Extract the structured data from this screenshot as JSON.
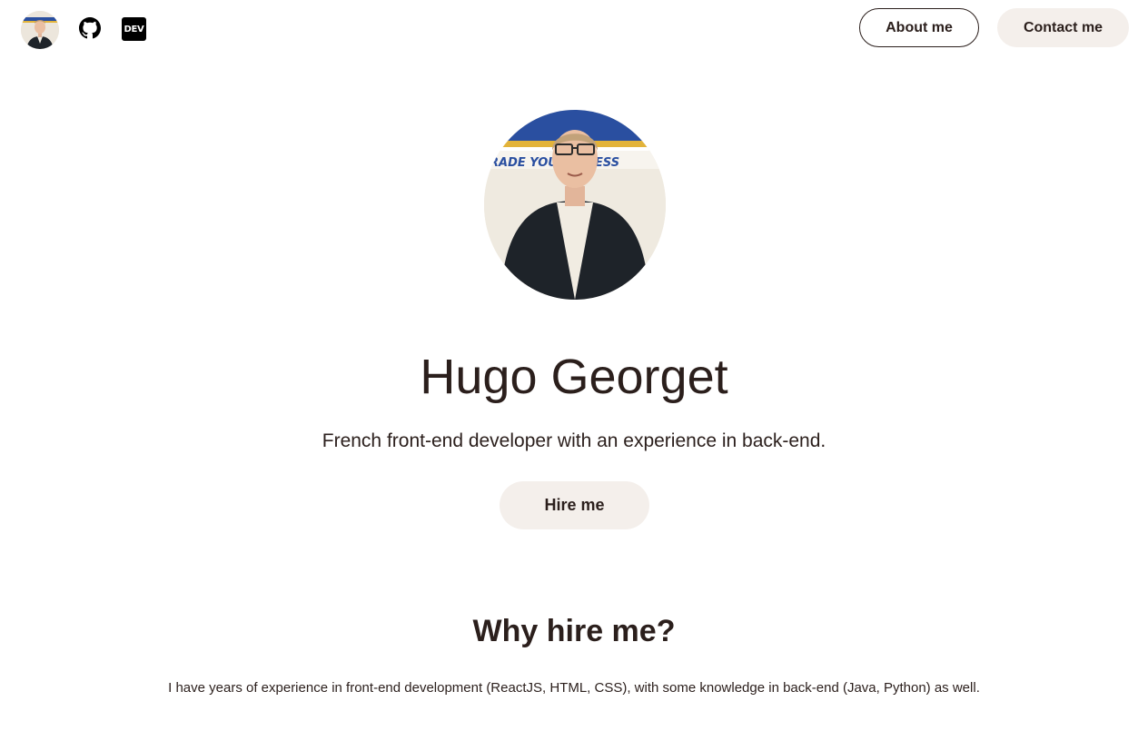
{
  "header": {
    "avatar_icon": "profile-photo-icon",
    "github_icon": "github-icon",
    "dev_label": "DEV",
    "about_label": "About me",
    "contact_label": "Contact me"
  },
  "hero": {
    "name": "Hugo Georget",
    "tagline": "French front-end developer with an experience in back-end.",
    "hire_label": "Hire me",
    "photo_icon": "profile-photo-icon"
  },
  "why": {
    "title": "Why hire me?",
    "text": "I have years of experience in front-end development (ReactJS, HTML, CSS), with some knowledge in back-end (Java, Python) as well."
  },
  "colors": {
    "text": "#2b1f1c",
    "button_bg": "#f4efeb",
    "background": "#ffffff"
  }
}
